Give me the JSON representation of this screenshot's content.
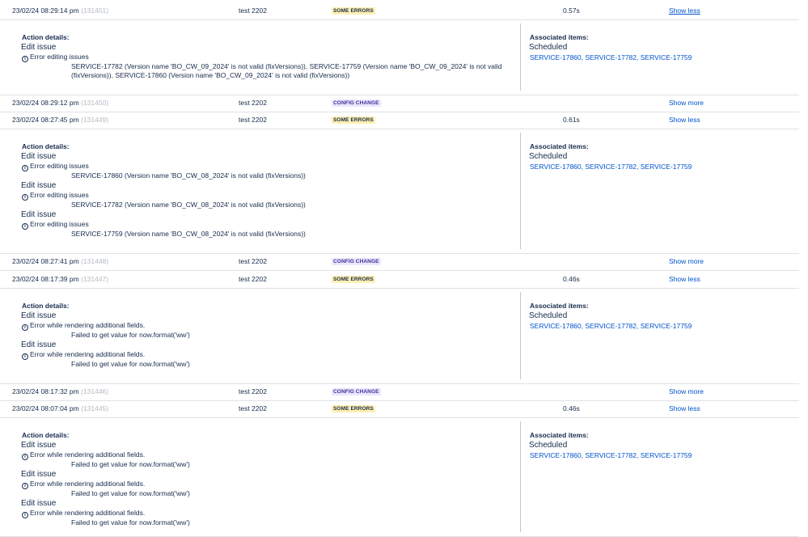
{
  "rows": [
    {
      "date": "23/02/24 08:29:14 pm",
      "id": "(131451)",
      "rule": "test 2202",
      "status": "SOME ERRORS",
      "duration": "0.57s",
      "action": "Show less"
    },
    {
      "date": "23/02/24 08:29:12 pm",
      "id": "(131450)",
      "rule": "test 2202",
      "status": "CONFIG CHANGE",
      "duration": "",
      "action": "Show more"
    },
    {
      "date": "23/02/24 08:27:45 pm",
      "id": "(131449)",
      "rule": "test 2202",
      "status": "SOME ERRORS",
      "duration": "0.61s",
      "action": "Show less"
    },
    {
      "date": "23/02/24 08:27:41 pm",
      "id": "(131448)",
      "rule": "test 2202",
      "status": "CONFIG CHANGE",
      "duration": "",
      "action": "Show more"
    },
    {
      "date": "23/02/24 08:17:39 pm",
      "id": "(131447)",
      "rule": "test 2202",
      "status": "SOME ERRORS",
      "duration": "0.46s",
      "action": "Show less"
    },
    {
      "date": "23/02/24 08:17:32 pm",
      "id": "(131446)",
      "rule": "test 2202",
      "status": "CONFIG CHANGE",
      "duration": "",
      "action": "Show more"
    },
    {
      "date": "23/02/24 08:07:04 pm",
      "id": "(131445)",
      "rule": "test 2202",
      "status": "SOME ERRORS",
      "duration": "0.46s",
      "action": "Show less"
    }
  ],
  "labels": {
    "action_details": "Action details:",
    "associated_items": "Associated items:",
    "scheduled": "Scheduled",
    "edit_issue": "Edit issue",
    "info_icon": "info-icon"
  },
  "details": [
    {
      "actions": [
        {
          "title": "Edit issue",
          "error": "Error editing issues",
          "message": "SERVICE-17782 (Version name 'BO_CW_09_2024' is not valid (fixVersions)), SERVICE-17759 (Version name 'BO_CW_09_2024' is not valid (fixVersions)), SERVICE-17860 (Version name 'BO_CW_09_2024' is not valid (fixVersions))"
        }
      ],
      "items": [
        "SERVICE-17860",
        "SERVICE-17782",
        "SERVICE-17759"
      ]
    },
    {
      "actions": [
        {
          "title": "Edit issue",
          "error": "Error editing issues",
          "message": "SERVICE-17860 (Version name 'BO_CW_08_2024' is not valid (fixVersions))"
        },
        {
          "title": "Edit issue",
          "error": "Error editing issues",
          "message": "SERVICE-17782 (Version name 'BO_CW_08_2024' is not valid (fixVersions))"
        },
        {
          "title": "Edit issue",
          "error": "Error editing issues",
          "message": "SERVICE-17759 (Version name 'BO_CW_08_2024' is not valid (fixVersions))"
        }
      ],
      "items": [
        "SERVICE-17860",
        "SERVICE-17782",
        "SERVICE-17759"
      ]
    },
    {
      "actions": [
        {
          "title": "Edit issue",
          "error": "Error while rendering additional fields.",
          "message": "Failed to get value for now.format('ww')"
        },
        {
          "title": "Edit issue",
          "error": "Error while rendering additional fields.",
          "message": "Failed to get value for now.format('ww')"
        }
      ],
      "items": [
        "SERVICE-17860",
        "SERVICE-17782",
        "SERVICE-17759"
      ]
    },
    {
      "actions": [
        {
          "title": "Edit issue",
          "error": "Error while rendering additional fields.",
          "message": "Failed to get value for now.format('ww')"
        },
        {
          "title": "Edit issue",
          "error": "Error while rendering additional fields.",
          "message": "Failed to get value for now.format('ww')"
        },
        {
          "title": "Edit issue",
          "error": "Error while rendering additional fields.",
          "message": "Failed to get value for now.format('ww')"
        }
      ],
      "items": [
        "SERVICE-17860",
        "SERVICE-17782",
        "SERVICE-17759"
      ]
    }
  ]
}
